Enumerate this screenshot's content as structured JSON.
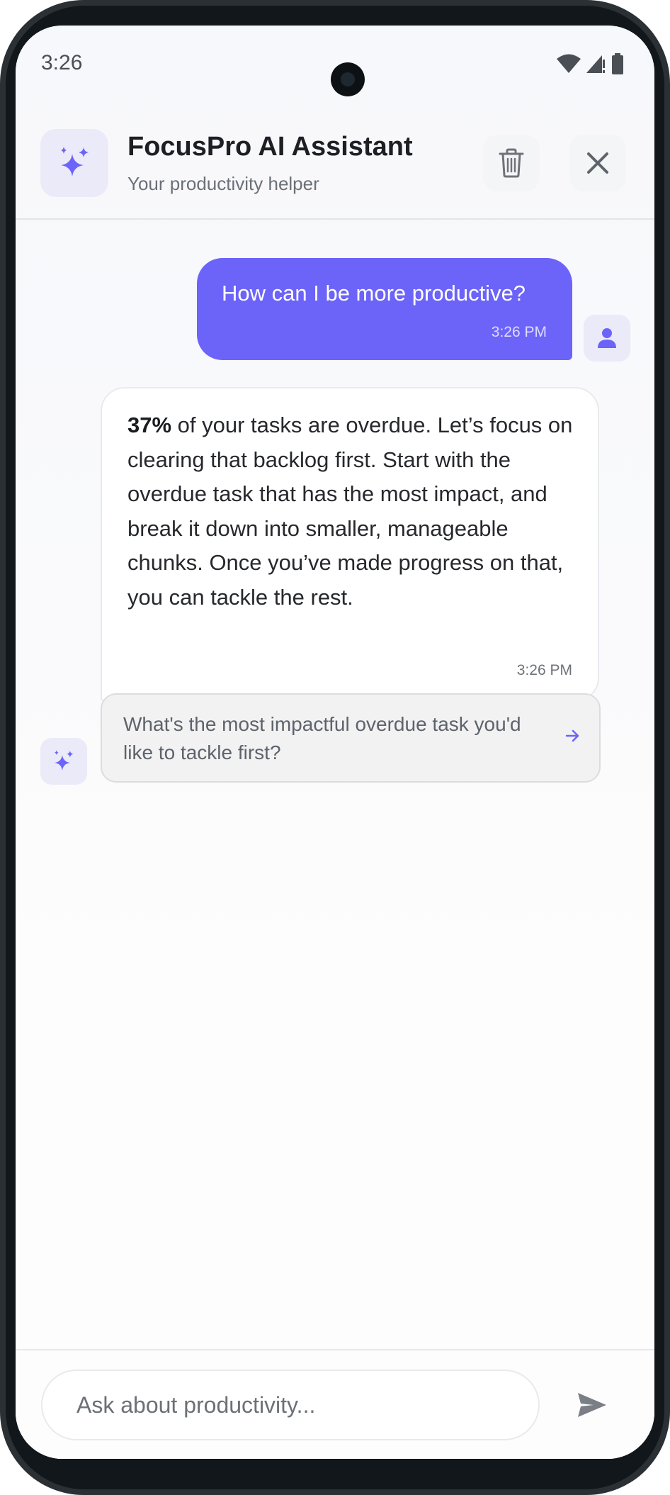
{
  "status_bar": {
    "time": "3:26"
  },
  "header": {
    "title": "FocusPro AI Assistant",
    "subtitle": "Your productivity helper",
    "icon": "sparkles-icon",
    "actions": [
      "trash-icon",
      "close-icon"
    ]
  },
  "messages": [
    {
      "sender": "user",
      "text": "How can I be more productive?",
      "time": "3:26 PM"
    },
    {
      "sender": "assistant",
      "highlight": "37%",
      "text": " of your tasks are overdue. Let’s focus on clearing that backlog first. Start with the overdue task that has the most impact, and break it down into smaller, manageable chunks. Once you’ve made progress on that, you can tackle the rest.",
      "time": "3:26 PM"
    }
  ],
  "suggestion": {
    "text": "What's the most impactful overdue task you'd like to tackle first?"
  },
  "input": {
    "placeholder": "Ask about productivity...",
    "value": ""
  },
  "colors": {
    "accent": "#6c63f9",
    "accent_light": "#ebeaf8"
  }
}
